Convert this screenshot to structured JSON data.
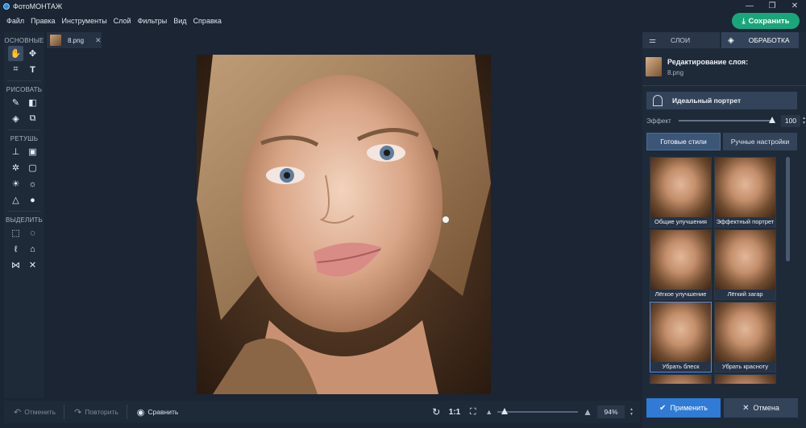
{
  "app": {
    "title": "ФотоМОНТАЖ"
  },
  "window": {
    "minimize": "—",
    "restore": "❐",
    "close": "✕"
  },
  "menu": [
    "Файл",
    "Правка",
    "Инструменты",
    "Слой",
    "Фильтры",
    "Вид",
    "Справка"
  ],
  "save_button": {
    "label": "Сохранить",
    "icon": "download-icon"
  },
  "left_tools": {
    "sections": [
      {
        "title": "ОСНОВНЫЕ"
      },
      {
        "title": "РИСОВАТЬ"
      },
      {
        "title": "РЕТУШЬ"
      },
      {
        "title": "ВЫДЕЛИТЬ"
      }
    ]
  },
  "document": {
    "tab_name": "8.png",
    "close": "✕"
  },
  "bottom": {
    "undo": "Отменить",
    "redo": "Повторить",
    "compare": "Сравнить",
    "fit": "1:1",
    "zoom": "94%",
    "zoom_level": 0.09
  },
  "right_panel": {
    "tabs": [
      {
        "label": "СЛОИ",
        "active": false
      },
      {
        "label": "ОБРАБОТКА",
        "active": true
      }
    ],
    "layer": {
      "title": "Редактирование слоя:",
      "file": "8.png"
    },
    "preset": "Идеальный портрет",
    "effect": {
      "label": "Эффект",
      "value": "100",
      "level": 1.0
    },
    "style_tabs": [
      {
        "label": "Готовые стили",
        "active": true
      },
      {
        "label": "Ручные настройки",
        "active": false
      }
    ],
    "styles": [
      {
        "label": "Общие улучшения",
        "selected": false
      },
      {
        "label": "Эффектный портрет",
        "selected": false
      },
      {
        "label": "Лёгкое улучшение",
        "selected": false
      },
      {
        "label": "Лёгкий загар",
        "selected": false
      },
      {
        "label": "Убрать блеск",
        "selected": true
      },
      {
        "label": "Убрать красноту",
        "selected": false
      }
    ],
    "apply": "Применить",
    "cancel": "Отмена"
  }
}
